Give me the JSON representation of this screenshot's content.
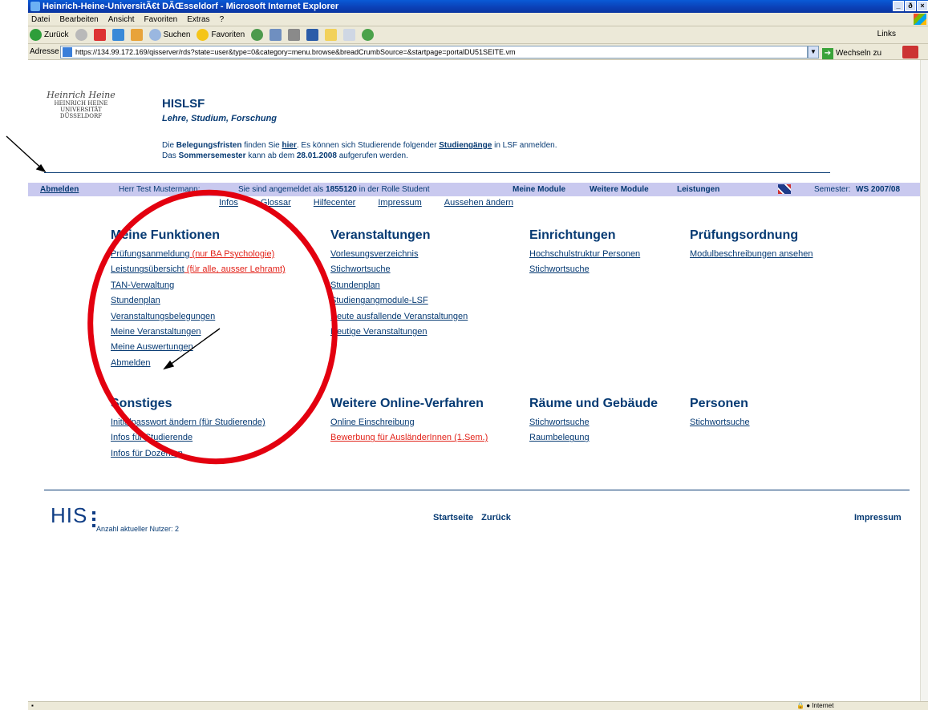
{
  "window": {
    "title": "Heinrich-Heine-UniversitÃ€t DÃŒsseldorf - Microsoft Internet Explorer",
    "controls": [
      "_",
      "ð",
      "×"
    ]
  },
  "menubar": [
    "Datei",
    "Bearbeiten",
    "Ansicht",
    "Favoriten",
    "Extras",
    "?"
  ],
  "toolbar": {
    "back": "Zurück",
    "search": "Suchen",
    "favorites": "Favoriten",
    "links": "Links"
  },
  "address": {
    "label": "Adresse",
    "url": "https://134.99.172.169/qisserver/rds?state=user&type=0&category=menu.browse&breadCrumbSource=&startpage=portalDU51SEITE.vm",
    "go": "Wechseln zu"
  },
  "header": {
    "logo_signature": "Heinrich Heine",
    "logo_lines": [
      "HEINRICH HEINE",
      "UNIVERSITÄT",
      "DÜSSELDORF"
    ],
    "title": "HISLSF",
    "subtitle": "Lehre, Studium, Forschung",
    "notice1_a": "Die ",
    "notice1_b": "Belegungsfristen",
    "notice1_c": " finden Sie ",
    "notice1_link": "hier",
    "notice1_d": ". Es können sich Studierende folgender ",
    "notice1_link2": "Studiengänge",
    "notice1_e": " in LSF anmelden.",
    "notice2_a": "Das ",
    "notice2_b": "Sommersemester",
    "notice2_c": " kann ab dem ",
    "notice2_d": "28.01.2008",
    "notice2_e": " aufgerufen werden."
  },
  "navbar": {
    "logout": "Abmelden",
    "user": "Herr Test Mustermann:",
    "login_a": "Sie sind angemeldet als ",
    "login_id": "1855120",
    "login_b": " in der Rolle Student",
    "meine_module": "Meine Module",
    "weitere_module": "Weitere Module",
    "leistungen": "Leistungen",
    "semester_label": "Semester:",
    "semester_value": "WS 2007/08"
  },
  "subnav": [
    "Infos",
    "Glossar",
    "Hilfecenter",
    "Impressum",
    "Aussehen ändern"
  ],
  "sections": {
    "meine_funktionen": {
      "title": "Meine Funktionen",
      "items": [
        "Prüfungsanmeldung",
        "Leistungsübersicht",
        "TAN-Verwaltung",
        "Stundenplan",
        "Veranstaltungsbelegungen",
        "Meine Veranstaltungen",
        "Meine Auswertungen",
        "Abmelden"
      ],
      "notes": [
        " (nur BA Psychologie)",
        " (für alle, ausser Lehramt)"
      ]
    },
    "veranstaltungen": {
      "title": "Veranstaltungen",
      "items": [
        "Vorlesungsverzeichnis",
        "Stichwortsuche",
        "Stundenplan",
        "Studiengangmodule-LSF",
        "Heute ausfallende Veranstaltungen",
        "Heutige Veranstaltungen"
      ]
    },
    "einrichtungen": {
      "title": "Einrichtungen",
      "items": [
        "Hochschulstruktur Personen",
        "Stichwortsuche"
      ]
    },
    "pruefungsordnung": {
      "title": "Prüfungsordnung",
      "items": [
        "Modulbeschreibungen ansehen"
      ]
    },
    "sonstiges": {
      "title": "Sonstiges",
      "items": [
        "Initialpasswort ändern (für Studierende)",
        "Infos für Studierende",
        "Infos für Dozenten"
      ]
    },
    "online": {
      "title": "Weitere Online-Verfahren",
      "items": [
        "Online Einschreibung",
        "Bewerbung für AusländerInnen (1.Sem.)"
      ]
    },
    "raeume": {
      "title": "Räume und Gebäude",
      "items": [
        "Stichwortsuche",
        "Raumbelegung"
      ]
    },
    "personen": {
      "title": "Personen",
      "items": [
        "Stichwortsuche"
      ]
    }
  },
  "footer": {
    "his": "HIS",
    "nutzer": "Anzahl aktueller Nutzer: 2",
    "startseite": "Startseite",
    "zurueck": "Zurück",
    "impressum": "Impressum"
  },
  "statusbar": {
    "zone": "Internet"
  },
  "colors": {
    "link": "#063a73",
    "highlight_red": "#e2231a",
    "navbar_bg": "#c9c9ef",
    "annotation_circle": "#e3000f"
  }
}
